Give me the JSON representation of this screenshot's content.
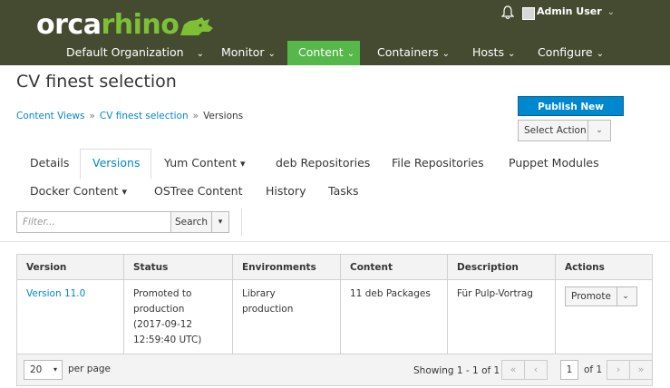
{
  "brand": {
    "part1": "orca",
    "part2": "rhino"
  },
  "header": {
    "user_name": "Admin User",
    "organization": "Default Organization",
    "nav": [
      {
        "label": "Monitor"
      },
      {
        "label": "Content"
      },
      {
        "label": "Containers"
      },
      {
        "label": "Hosts"
      },
      {
        "label": "Configure"
      }
    ]
  },
  "page": {
    "title": "CV finest selection",
    "breadcrumb": [
      "Content Views",
      "CV finest selection",
      "Versions"
    ],
    "publish_label": "Publish New Version",
    "select_action_label": "Select Action"
  },
  "tabs": {
    "row1": [
      "Details",
      "Versions",
      "Yum Content",
      "deb Repositories",
      "File Repositories",
      "Puppet Modules"
    ],
    "row2": [
      "Docker Content",
      "OSTree Content",
      "History",
      "Tasks"
    ]
  },
  "filter": {
    "placeholder": "Filter...",
    "search_label": "Search"
  },
  "table": {
    "headers": [
      "Version",
      "Status",
      "Environments",
      "Content",
      "Description",
      "Actions"
    ],
    "row": {
      "version": "Version 11.0",
      "status": [
        "Promoted to",
        "production",
        "(2017-09-12",
        "12:59:40 UTC)"
      ],
      "environments": [
        "Library",
        "production"
      ],
      "content": "11 deb Packages",
      "description": "Für Pulp-Vortrag",
      "action_label": "Promote"
    }
  },
  "pagination": {
    "per_page_value": "20",
    "per_page_label": "per page",
    "showing": "Showing 1 - 1 of 1",
    "page": "1",
    "of_pages": "of 1"
  },
  "colors": {
    "header_bg": "#444b31",
    "nav_active": "#56b74a",
    "link": "#0088ce",
    "brand_green": "#7ec035"
  }
}
